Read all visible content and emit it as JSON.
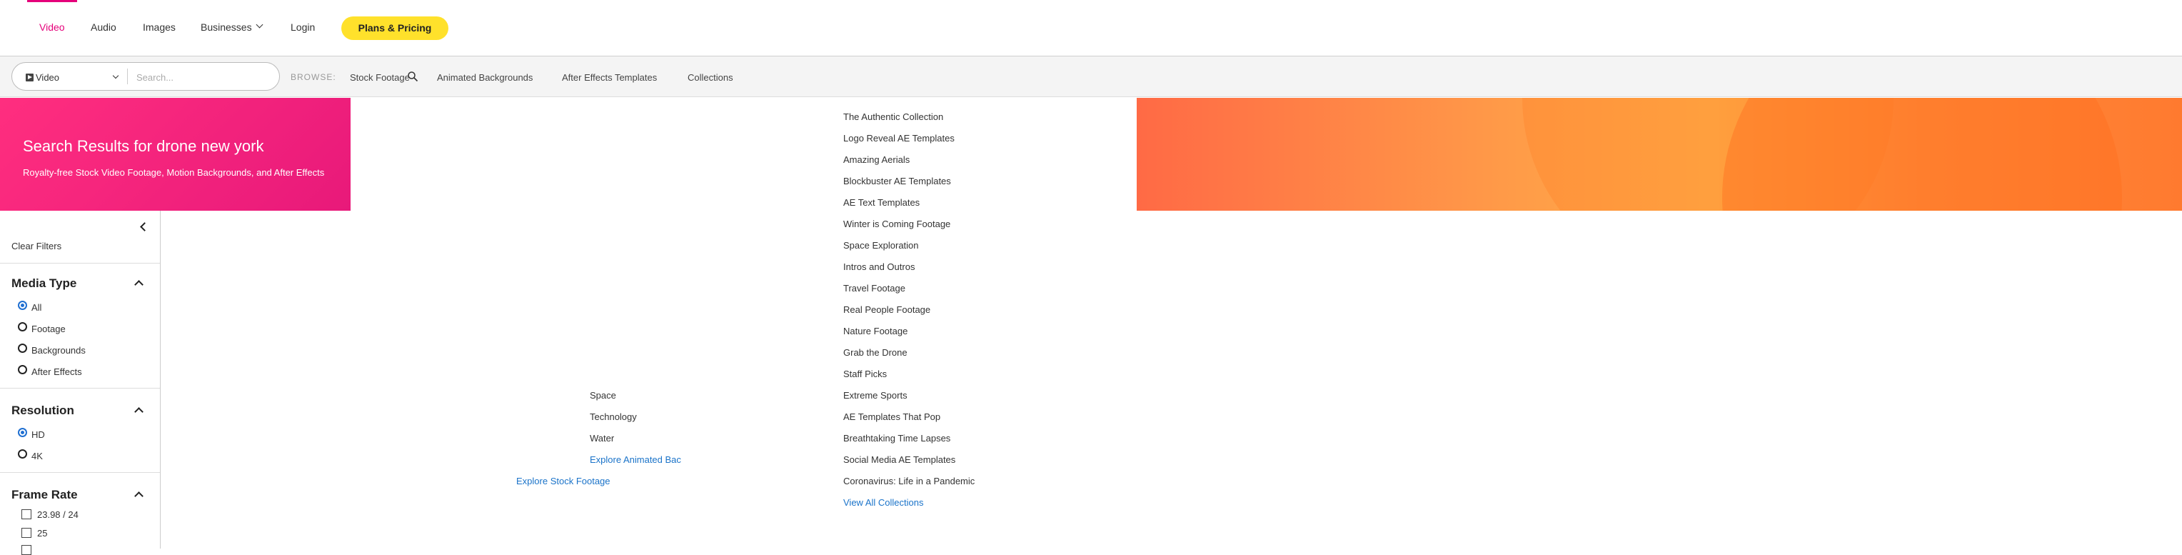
{
  "nav": {
    "items": [
      "Video",
      "Audio",
      "Images",
      "Businesses",
      "Login"
    ],
    "plans_label": "Plans & Pricing"
  },
  "search": {
    "media_type": "Video",
    "placeholder": "Search...",
    "browse_label": "BROWSE:",
    "browse_links": [
      "Stock Footage",
      "Animated Backgrounds",
      "After Effects Templates",
      "Collections"
    ]
  },
  "banner": {
    "title": "Search Results for drone new york",
    "subtitle": "Royalty-free Stock Video Footage, Motion Backgrounds, and After Effects"
  },
  "sidebar": {
    "clear_filters": "Clear Filters",
    "media_type": {
      "title": "Media Type",
      "options": [
        "All",
        "Footage",
        "Backgrounds",
        "After Effects"
      ],
      "selected": 0
    },
    "resolution": {
      "title": "Resolution",
      "options": [
        "HD",
        "4K"
      ],
      "selected": 0
    },
    "frame_rate": {
      "title": "Frame Rate",
      "options": [
        "23.98 / 24",
        "25"
      ]
    }
  },
  "menus": {
    "backgrounds": [
      "Space",
      "Technology",
      "Water"
    ],
    "explore_backgrounds": "Explore Animated Bac",
    "explore_footage": "Explore Stock Footage",
    "collections": [
      "The Authentic Collection",
      "Logo Reveal AE Templates",
      "Amazing Aerials",
      "Blockbuster AE Templates",
      "AE Text Templates",
      "Winter is Coming Footage",
      "Space Exploration",
      "Intros and Outros",
      "Travel Footage",
      "Real People Footage",
      "Nature Footage",
      "Grab the Drone",
      "Staff Picks",
      "Extreme Sports",
      "AE Templates That Pop",
      "Breathtaking Time Lapses",
      "Social Media AE Templates",
      "Coronavirus: Life in a Pandemic"
    ],
    "view_all": "View All Collections"
  },
  "colors": {
    "accent_pink": "#e5007a",
    "cta_yellow": "#ffe12b",
    "link_blue": "#1a73c9",
    "radio_blue": "#1f6fd1"
  }
}
